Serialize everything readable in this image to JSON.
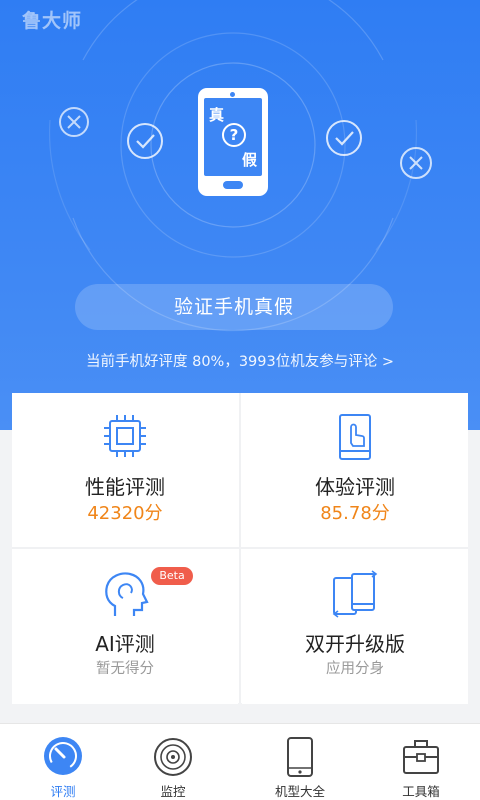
{
  "app": {
    "logo_text": "鲁大师"
  },
  "hero": {
    "phone_label_top": "真",
    "phone_label_question": "?",
    "phone_label_bottom": "假",
    "verify_button": "验证手机真假",
    "rating_text": "当前手机好评度 80%，3993位机友参与评论 >"
  },
  "cards": [
    {
      "title": "性能评测",
      "value": "42320分",
      "icon": "cpu-chip-icon"
    },
    {
      "title": "体验评测",
      "value": "85.78分",
      "icon": "phone-touch-icon"
    },
    {
      "title": "AI评测",
      "subtitle": "暂无得分",
      "badge": "Beta",
      "icon": "ai-head-icon"
    },
    {
      "title": "双开升级版",
      "subtitle": "应用分身",
      "icon": "dual-phones-icon"
    }
  ],
  "tabs": [
    {
      "label": "评测",
      "icon": "speedometer-icon",
      "active": true
    },
    {
      "label": "监控",
      "icon": "monitor-disc-icon",
      "active": false
    },
    {
      "label": "机型大全",
      "icon": "phone-catalog-icon",
      "active": false
    },
    {
      "label": "工具箱",
      "icon": "toolbox-icon",
      "active": false
    }
  ],
  "colors": {
    "primary": "#3d86f4",
    "accent": "#f08519",
    "badge": "#f05d4b"
  }
}
